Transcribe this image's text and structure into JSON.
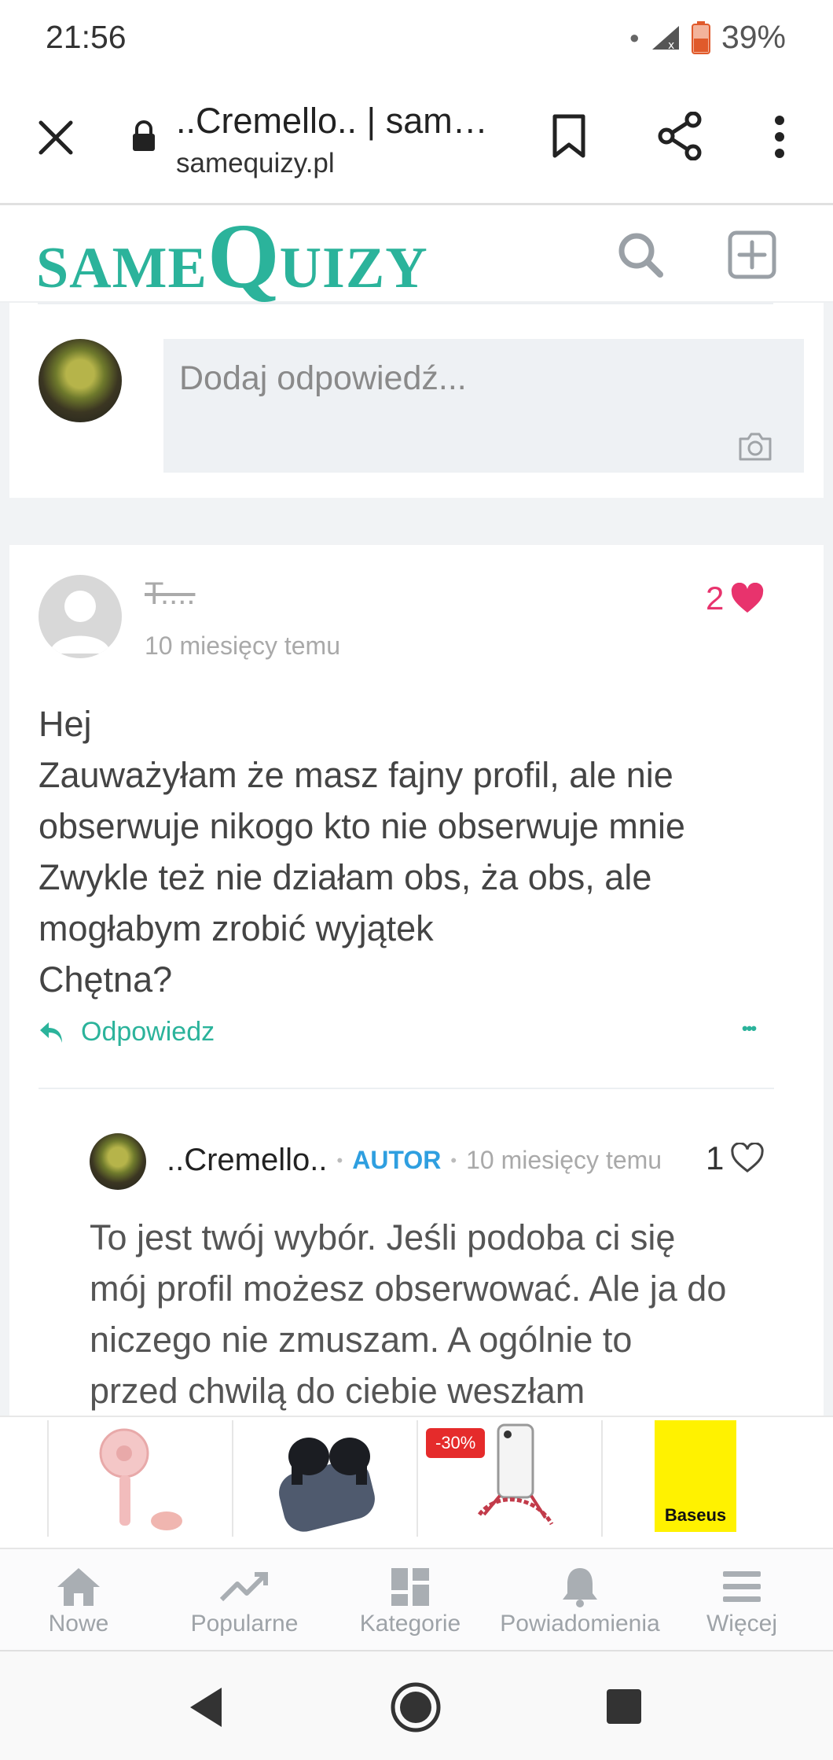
{
  "status_bar": {
    "time": "21:56",
    "battery": "39%"
  },
  "browser": {
    "title": "..Cremello.. | sam…",
    "url": "samequizy.pl"
  },
  "site": {
    "logo_same": "SAME",
    "logo_q": "Q",
    "logo_uizy": "UIZY",
    "brand_color": "#2bb39b"
  },
  "composer": {
    "placeholder": "Dodaj odpowiedź..."
  },
  "comment": {
    "author": "T....",
    "time": "10 miesięcy temu",
    "likes": "2",
    "lines": [
      "Hej",
      "Zauważyłam że masz fajny profil, ale nie",
      "obserwuje nikogo kto nie obserwuje mnie",
      "Zwykle też nie działam obs, ża obs, ale",
      "mogłabym zrobić wyjątek",
      "Chętna?"
    ],
    "reply_label": "Odpowiedz",
    "more_label": "•••"
  },
  "reply": {
    "author": "..Cremello..",
    "badge": "AUTOR",
    "time": "10 miesięcy temu",
    "likes": "1",
    "lines": [
      "To jest twój wybór. Jeśli podoba ci się",
      "mój profil możesz obserwować. Ale ja do",
      "niczego nie zmuszam. A ogólnie to",
      "przed chwilą do ciebie weszłam"
    ]
  },
  "ad": {
    "discount": "-30%",
    "brand": "Baseus"
  },
  "nav": {
    "items": [
      {
        "label": "Nowe",
        "icon": "home-icon"
      },
      {
        "label": "Popularne",
        "icon": "trending-icon"
      },
      {
        "label": "Kategorie",
        "icon": "grid-icon"
      },
      {
        "label": "Powiadomienia",
        "icon": "bell-icon"
      },
      {
        "label": "Więcej",
        "icon": "menu-icon"
      }
    ]
  }
}
